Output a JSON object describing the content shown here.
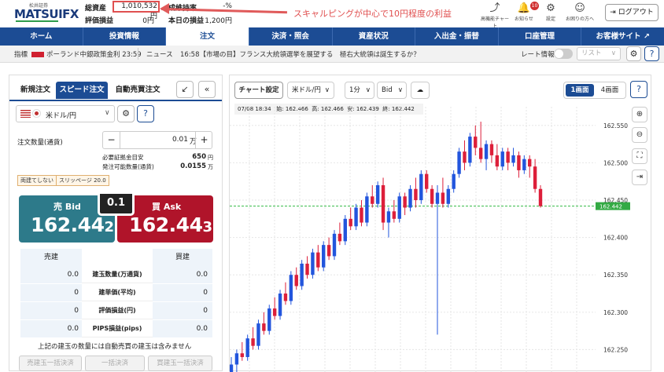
{
  "header": {
    "logo_small": "松井証券",
    "logo_matsui": "MATSUI",
    "logo_fx": "FX",
    "total_assets_label": "総資産",
    "total_assets_value": "1,010,532円",
    "maintenance_label": "成維持率",
    "maintenance_value": "-%",
    "eval_pl_label": "評価損益",
    "eval_pl_value": "0円",
    "today_pl_label": "本日の損益",
    "today_pl_value": "1,200円",
    "annotation": "スキャルピングが中心で10円程度の利益",
    "icons": [
      {
        "label": "高機能チャート",
        "icon": "chart-icon"
      },
      {
        "label": "お知らせ",
        "icon": "bell-icon",
        "badge": "10"
      },
      {
        "label": "設定",
        "icon": "gear-icon"
      },
      {
        "label": "お困りの方へ",
        "icon": "help-icon"
      }
    ],
    "logout_label": "ログアウト"
  },
  "nav": {
    "items": [
      "ホーム",
      "投資情報",
      "注文",
      "決済・照会",
      "資産状況",
      "入出金・振替",
      "口座管理",
      "お客様サイト"
    ]
  },
  "ticker": {
    "indicator_label": "指標",
    "indicator_text": "ポーランド中銀政策金利 23:59",
    "news_label": "ニュース",
    "news_text": "16:58【市場の目】フランス大統領選挙を展望する　極右大統領は誕生するか？",
    "rate_info_label": "レート情報",
    "list_label": "リスト"
  },
  "order": {
    "tabs": [
      "新規注文",
      "スピード注文",
      "自動売買注文"
    ],
    "pair": "米ドル/円",
    "qty_label": "注文数量(通貨)",
    "qty_value": "0.01",
    "qty_unit": "万",
    "margin_label": "必要証拠金目安",
    "margin_value": "650",
    "margin_unit": "円",
    "possible_label": "発注可能数量(通貨)",
    "possible_value": "0.0155",
    "possible_unit": "万",
    "tag1": "両建てしない",
    "tag2": "スリッページ  20.0",
    "bid_label": "売 Bid",
    "bid_big": "162.44",
    "bid_small": "2",
    "ask_label": "買 Ask",
    "ask_big": "162.44",
    "ask_small": "3",
    "spread": "0.1",
    "pos_header_sell": "売建",
    "pos_header_buy": "買建",
    "pos_rows": [
      {
        "label": "建玉数量(万通貨)",
        "sell": "0.0",
        "buy": "0.0"
      },
      {
        "label": "建単価(平均)",
        "sell": "0",
        "buy": "0"
      },
      {
        "label": "評価損益(円)",
        "sell": "0",
        "buy": "0"
      },
      {
        "label": "PIPS損益(pips)",
        "sell": "0.0",
        "buy": "0.0"
      }
    ],
    "note": "上記の建玉の数量には自動売買の建玉は含みません",
    "btn_sell_close": "売建玉一括決済",
    "btn_all_close": "一括決済",
    "btn_buy_close": "買建玉一括決済"
  },
  "chart_ui": {
    "settings_label": "チャート設定",
    "pair_select": "米ドル/円",
    "interval_select": "1分",
    "side_select": "Bid",
    "view1": "1画面",
    "view4": "4画面",
    "ohlc": {
      "time": "07/08 18:34",
      "o_label": "始:",
      "o": "162.466",
      "h_label": "高:",
      "h": "162.466",
      "l_label": "安:",
      "l": "162.439",
      "c_label": "終:",
      "c": "162.442"
    },
    "current_price": "162.442"
  },
  "chart_data": {
    "type": "candlestick",
    "y_ticks": [
      162.55,
      162.5,
      162.45,
      162.4,
      162.35,
      162.3,
      162.25
    ],
    "y_tick_labels": [
      "162.550",
      "162.500",
      "162.450",
      "162.400",
      "162.350",
      "162.300",
      "162.250"
    ],
    "ylim": [
      162.22,
      162.575
    ],
    "current": 162.442,
    "up_color": "#2255dd",
    "down_color": "#dd1f3a",
    "candles": [
      [
        162.22,
        162.24,
        162.21,
        162.23
      ],
      [
        162.23,
        162.25,
        162.22,
        162.245
      ],
      [
        162.245,
        162.26,
        162.235,
        162.24
      ],
      [
        162.24,
        162.27,
        162.235,
        162.265
      ],
      [
        162.265,
        162.28,
        162.25,
        162.255
      ],
      [
        162.255,
        162.29,
        162.25,
        162.285
      ],
      [
        162.285,
        162.3,
        162.27,
        162.275
      ],
      [
        162.275,
        162.31,
        162.27,
        162.305
      ],
      [
        162.305,
        162.32,
        162.29,
        162.295
      ],
      [
        162.295,
        162.33,
        162.29,
        162.325
      ],
      [
        162.325,
        162.34,
        162.31,
        162.315
      ],
      [
        162.315,
        162.355,
        162.31,
        162.35
      ],
      [
        162.35,
        162.36,
        162.33,
        162.335
      ],
      [
        162.335,
        162.37,
        162.33,
        162.365
      ],
      [
        162.365,
        162.375,
        162.345,
        162.35
      ],
      [
        162.35,
        162.385,
        162.345,
        162.38
      ],
      [
        162.38,
        162.39,
        162.355,
        162.36
      ],
      [
        162.36,
        162.395,
        162.355,
        162.39
      ],
      [
        162.39,
        162.4,
        162.37,
        162.375
      ],
      [
        162.375,
        162.41,
        162.37,
        162.405
      ],
      [
        162.405,
        162.42,
        162.39,
        162.395
      ],
      [
        162.395,
        162.43,
        162.39,
        162.425
      ],
      [
        162.425,
        162.44,
        162.41,
        162.415
      ],
      [
        162.415,
        162.445,
        162.41,
        162.44
      ],
      [
        162.44,
        162.45,
        162.415,
        162.42
      ],
      [
        162.42,
        162.46,
        162.415,
        162.455
      ],
      [
        162.455,
        162.47,
        162.44,
        162.445
      ],
      [
        162.445,
        162.475,
        162.44,
        162.47
      ],
      [
        162.47,
        162.48,
        162.41,
        162.42
      ],
      [
        162.42,
        162.44,
        162.4,
        162.435
      ],
      [
        162.435,
        162.45,
        162.42,
        162.425
      ],
      [
        162.425,
        162.46,
        162.42,
        162.455
      ],
      [
        162.455,
        162.46,
        162.43,
        162.44
      ],
      [
        162.44,
        162.47,
        162.435,
        162.465
      ],
      [
        162.465,
        162.48,
        162.44,
        162.45
      ],
      [
        162.45,
        162.49,
        162.445,
        162.485
      ],
      [
        162.485,
        162.49,
        162.46,
        162.465
      ],
      [
        162.465,
        162.47,
        162.44,
        162.445
      ],
      [
        162.445,
        162.47,
        162.27,
        162.46
      ],
      [
        162.46,
        162.48,
        162.44,
        162.445
      ],
      [
        162.445,
        162.47,
        162.44,
        162.465
      ],
      [
        162.465,
        162.49,
        162.46,
        162.485
      ],
      [
        162.485,
        162.52,
        162.48,
        162.515
      ],
      [
        162.515,
        162.53,
        162.49,
        162.5
      ],
      [
        162.5,
        162.54,
        162.495,
        162.535
      ],
      [
        162.535,
        162.55,
        162.51,
        162.52
      ],
      [
        162.52,
        162.555,
        162.5,
        162.505
      ],
      [
        162.505,
        162.53,
        162.49,
        162.525
      ],
      [
        162.525,
        162.53,
        162.5,
        162.51
      ],
      [
        162.51,
        162.525,
        162.49,
        162.495
      ],
      [
        162.495,
        162.52,
        162.49,
        162.515
      ],
      [
        162.515,
        162.52,
        162.49,
        162.5
      ],
      [
        162.5,
        162.52,
        162.495,
        162.51
      ],
      [
        162.51,
        162.515,
        162.48,
        162.49
      ],
      [
        162.49,
        162.51,
        162.485,
        162.505
      ],
      [
        162.505,
        162.51,
        162.48,
        162.495
      ],
      [
        162.495,
        162.505,
        162.46,
        162.465
      ],
      [
        162.465,
        162.47,
        162.44,
        162.442
      ]
    ]
  }
}
